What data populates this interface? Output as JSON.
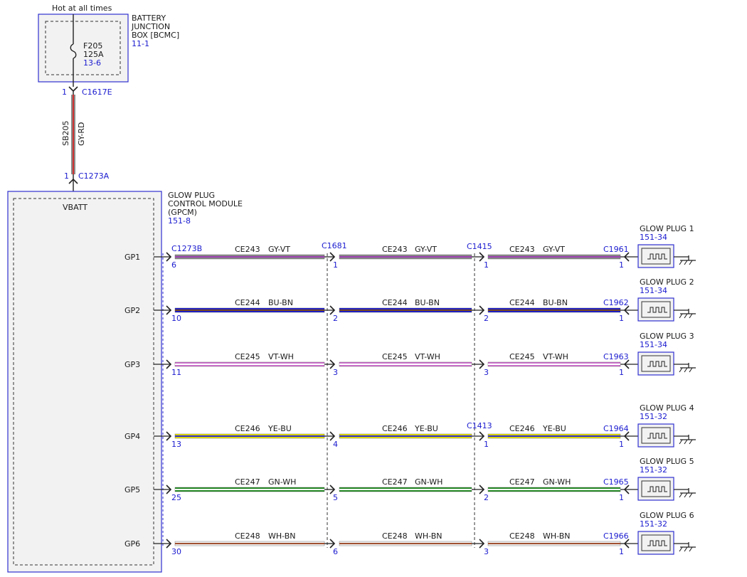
{
  "top": {
    "hot_label": "Hot at all times",
    "bjb_name": [
      "BATTERY",
      "JUNCTION",
      "BOX [BCMC]"
    ],
    "bjb_ref": "11-1",
    "fuse_id": "F205",
    "fuse_rating": "125A",
    "fuse_ref": "13-6",
    "conn_top_pin": "1",
    "conn_top": "C1617E",
    "feed_circuit": "SB205",
    "feed_color": "GY-RD",
    "conn_bottom_pin": "1",
    "conn_bottom": "C1273A"
  },
  "gpcm": {
    "name": [
      "GLOW PLUG",
      "CONTROL MODULE",
      "(GPCM)"
    ],
    "ref": "151-8",
    "vbatt": "VBATT",
    "inline_connector": "C1273B"
  },
  "mid_connectors": {
    "c1": "C1681",
    "c2": "C1415",
    "c3": "C1413"
  },
  "rows": [
    {
      "pin_label": "GP1",
      "circuit": "CE243",
      "color": "GY-VT",
      "wire_main": "#8a8a8a",
      "wire_stripe": "#9b3fb0",
      "pin_a": "6",
      "pin_b": "1",
      "pin_c": "1",
      "end_pin": "1",
      "connector": "C1961",
      "plug": "GLOW PLUG 1",
      "plug_ref": "151-34"
    },
    {
      "pin_label": "GP2",
      "circuit": "CE244",
      "color": "BU-BN",
      "wire_main": "#1a1acc",
      "wire_stripe": "#7a4a1a",
      "pin_a": "10",
      "pin_b": "2",
      "pin_c": "2",
      "end_pin": "1",
      "connector": "C1962",
      "plug": "GLOW PLUG 2",
      "plug_ref": "151-34"
    },
    {
      "pin_label": "GP3",
      "circuit": "CE245",
      "color": "VT-WH",
      "wire_main": "#d070d0",
      "wire_stripe": "#ffffff",
      "pin_a": "11",
      "pin_b": "3",
      "pin_c": "3",
      "end_pin": "1",
      "connector": "C1963",
      "plug": "GLOW PLUG 3",
      "plug_ref": "151-34"
    },
    {
      "pin_label": "GP4",
      "circuit": "CE246",
      "color": "YE-BU",
      "wire_main": "#e8e000",
      "wire_stripe": "#2a2acc",
      "pin_a": "13",
      "pin_b": "4",
      "pin_c": "1",
      "end_pin": "1",
      "connector": "C1964",
      "plug": "GLOW PLUG 4",
      "plug_ref": "151-32"
    },
    {
      "pin_label": "GP5",
      "circuit": "CE247",
      "color": "GN-WH",
      "wire_main": "#1e8a1e",
      "wire_stripe": "#ffffff",
      "pin_a": "25",
      "pin_b": "5",
      "pin_c": "2",
      "end_pin": "1",
      "connector": "C1965",
      "plug": "GLOW PLUG 5",
      "plug_ref": "151-32"
    },
    {
      "pin_label": "GP6",
      "circuit": "CE248",
      "color": "WH-BN",
      "wire_main": "#f4f4f4",
      "wire_stripe": "#a05030",
      "pin_a": "30",
      "pin_b": "6",
      "pin_c": "3",
      "end_pin": "1",
      "connector": "C1966",
      "plug": "GLOW PLUG 6",
      "plug_ref": "151-32"
    }
  ],
  "colors": {
    "ref_blue": "#1a1ad0",
    "box_blue": "#3030d0",
    "feed_wire": "#8a8a8a",
    "feed_stripe": "#d03030"
  }
}
